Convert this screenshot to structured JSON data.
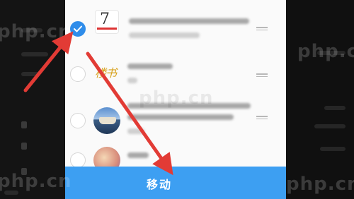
{
  "dialog": {
    "confirm_label": "移动",
    "items": [
      {
        "checked": true,
        "thumb": "calendar-thumbnail",
        "thumb_text": "7"
      },
      {
        "checked": false,
        "thumb": "gold-handwriting-thumbnail",
        "thumb_text": "楼书"
      },
      {
        "checked": false,
        "thumb": "ship-photo-thumbnail"
      },
      {
        "checked": false,
        "thumb": "portrait-photo-thumbnail"
      }
    ]
  },
  "watermark": {
    "text": "php.cn"
  },
  "colors": {
    "accent": "#3d9ff2",
    "check": "#2f8dea",
    "arrow": "#e23b35"
  },
  "annotations": [
    {
      "name": "arrow-to-checkbox",
      "color": "#e23b35"
    },
    {
      "name": "arrow-to-move-button",
      "color": "#e23b35"
    }
  ]
}
